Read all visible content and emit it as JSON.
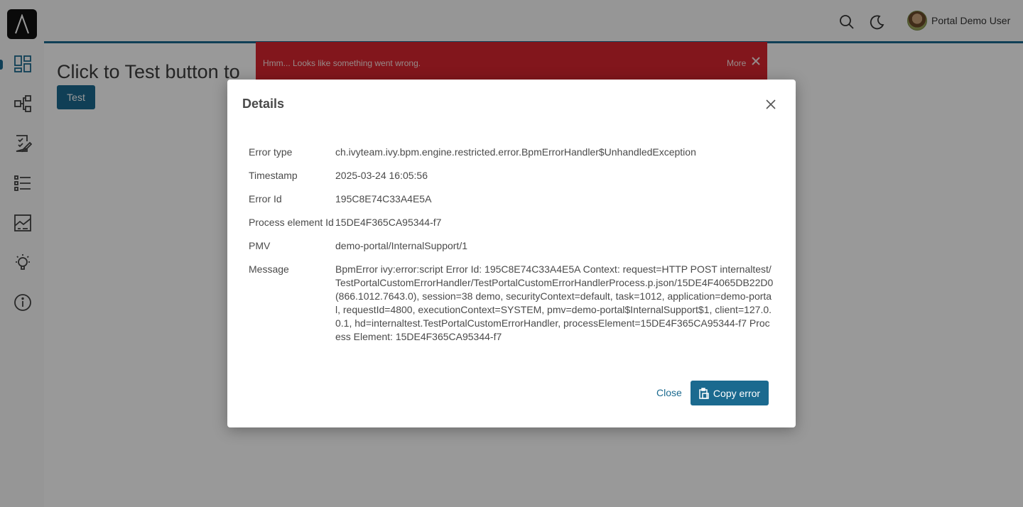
{
  "user": {
    "name": "Portal Demo User"
  },
  "page": {
    "heading": "Click to Test button to",
    "test_button": "Test"
  },
  "growl": {
    "message": "Hmm... Looks like something went wrong.",
    "more": "More"
  },
  "dialog": {
    "title": "Details",
    "rows": [
      {
        "label": "Error type",
        "value": "ch.ivyteam.ivy.bpm.engine.restricted.error.BpmErrorHandler$UnhandledException"
      },
      {
        "label": "Timestamp",
        "value": "2025-03-24 16:05:56"
      },
      {
        "label": "Error Id",
        "value": "195C8E74C33A4E5A"
      },
      {
        "label": "Process element Id",
        "value": "15DE4F365CA95344-f7"
      },
      {
        "label": "PMV",
        "value": "demo-portal/InternalSupport/1"
      },
      {
        "label": "Message",
        "value": "BpmError ivy:error:script Error Id: 195C8E74C33A4E5A Context: request=HTTP POST internaltest/TestPortalCustomErrorHandler/TestPortalCustomErrorHandlerProcess.p.json/15DE4F4065DB22D0(866.1012.7643.0), session=38 demo, securityContext=default, task=1012, application=demo-portal, requestId=4800, executionContext=SYSTEM, pmv=demo-portal$InternalSupport$1, client=127.0.0.1, hd=internaltest.TestPortalCustomErrorHandler, processElement=15DE4F365CA95344-f7 Process Element: 15DE4F365CA95344-f7"
      }
    ],
    "close_label": "Close",
    "copy_label": "Copy error"
  },
  "icons": {
    "logo": "axon-ivy-logo-icon",
    "nav": [
      "dashboard-icon",
      "processes-icon",
      "tasks-icon",
      "cases-icon",
      "statistics-icon",
      "idea-icon",
      "info-icon"
    ],
    "top": [
      "search-icon",
      "moon-icon"
    ]
  },
  "colors": {
    "accent": "#1b6a8f",
    "error": "#d9262f"
  }
}
